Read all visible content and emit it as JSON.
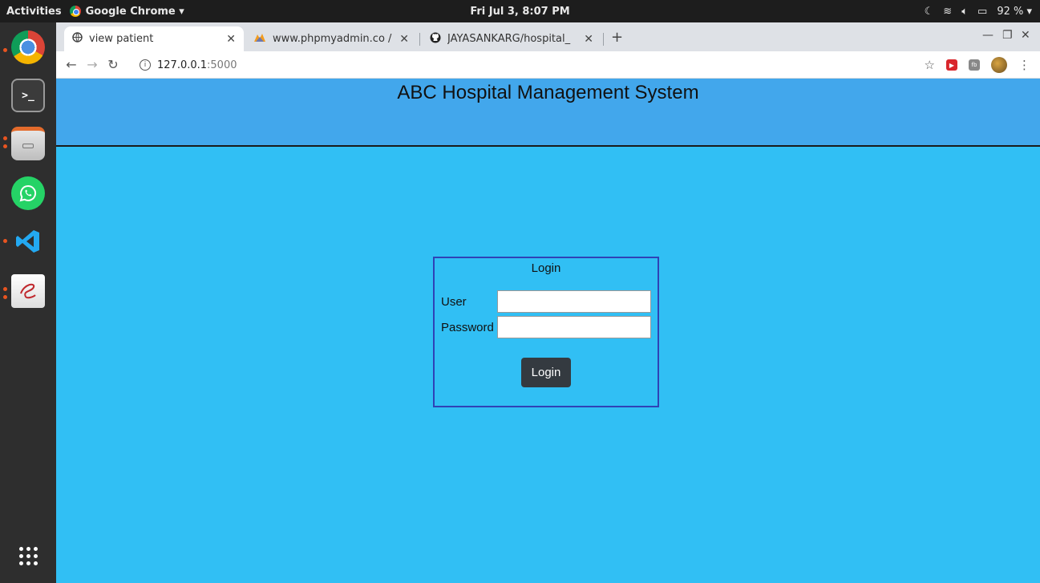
{
  "topbar": {
    "activities": "Activities",
    "app_menu": "Google Chrome ▾",
    "clock": "Fri Jul  3,  8:07 PM",
    "battery": "92 % ▾"
  },
  "browser": {
    "tabs": [
      {
        "label": "view patient",
        "icon": "globe-icon"
      },
      {
        "label": "www.phpmyadmin.co / sc",
        "icon": "phpmyadmin-icon"
      },
      {
        "label": "JAYASANKARG/hospital_",
        "icon": "github-icon"
      }
    ],
    "new_tab": "+",
    "url_host": "127.0.0.1",
    "url_port": ":5000"
  },
  "page": {
    "title": "ABC Hospital Management System",
    "login": {
      "legend": "Login",
      "user_label": "User",
      "password_label": "Password",
      "user_value": "",
      "password_value": "",
      "button_label": "Login"
    }
  },
  "colors": {
    "header_bg": "#42a7ec",
    "page_bg": "#31bff4",
    "box_border": "#2f42b6",
    "button_bg": "#343a40"
  }
}
